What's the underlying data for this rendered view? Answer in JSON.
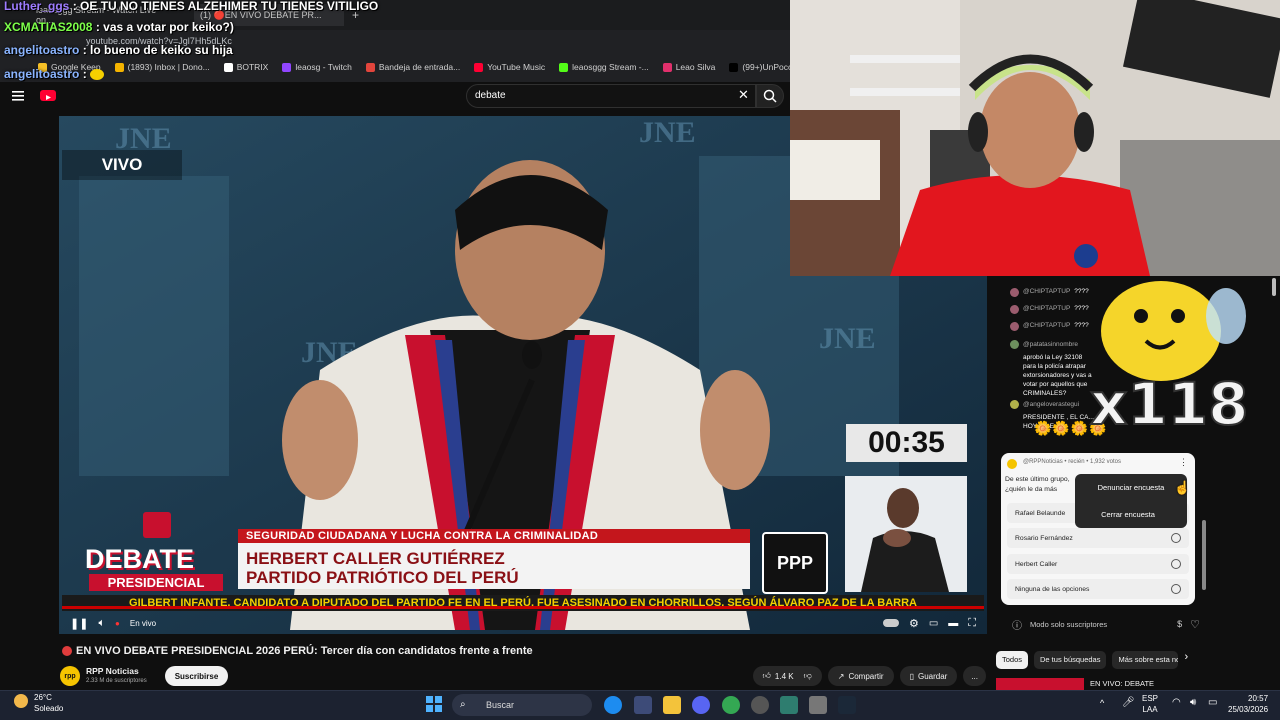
{
  "browser": {
    "tabs": [
      "leaosggg Stream - Watch Live on...",
      "(1) 🔴EN VIVO DEBATE PR..."
    ],
    "url": "youtube.com/watch?v=Jgl7Hh5dLKc",
    "bookmarks": [
      {
        "label": "Google Keep",
        "color": "#f6c026"
      },
      {
        "label": "(1893) Inbox | Dono...",
        "color": "#f5b400"
      },
      {
        "label": "BOTRIX",
        "color": "#ffffff"
      },
      {
        "label": "leaosg - Twitch",
        "color": "#9146ff"
      },
      {
        "label": "Bandeja de entrada...",
        "color": "#e2453c"
      },
      {
        "label": "YouTube Music",
        "color": "#ff0033"
      },
      {
        "label": "leaosggg Stream -...",
        "color": "#53fc18"
      },
      {
        "label": "Leao Silva",
        "color": "#e1306c"
      },
      {
        "label": "(99+)UnPocoDeLe...",
        "color": "#000000"
      }
    ]
  },
  "overlay_chat": [
    {
      "user": "Luther_ggs",
      "message": ": OE TU NO TIENES ALZEHIMER TU TIENES VITILIGO"
    },
    {
      "user": "XCMATIAS2008",
      "message": ": vas a votar por keiko?)"
    },
    {
      "user": "angelitoastro",
      "message": ": lo bueno de keiko su hija"
    },
    {
      "user": "angelitoastro",
      "message": ":"
    }
  ],
  "youtube": {
    "search_value": "debate",
    "video": {
      "live_tag": "VIVO",
      "jne": "JNE",
      "timer": "00:35",
      "ppp": "PPP",
      "lower_topic": "SEGURIDAD CIUDADANA Y LUCHA CONTRA LA CRIMINALIDAD",
      "name_line1": "HERBERT CALLER GUTIÉRREZ",
      "name_line2": "PARTIDO PATRIÓTICO DEL PERÚ",
      "debate_word": "DEBATE",
      "debate_sub": "PRESIDENCIAL",
      "ticker": "GILBERT INFANTE, CANDIDATO A DIPUTADO DEL PARTIDO FE EN EL PERÚ, FUE ASESINADO EN CHORRILLOS, SEGÚN ÁLVARO PAZ DE LA BARRA",
      "live_label": "En vivo"
    },
    "title": "EN VIVO DEBATE PRESIDENCIAL 2026 PERÚ: Tercer día con candidatos frente a frente",
    "channel": {
      "name": "RPP Noticias",
      "subs": "2.33 M de suscriptores",
      "subscribe": "Suscribirse",
      "avatar_text": "rpp"
    },
    "actions": {
      "likes": "1.4 K",
      "share": "Compartir",
      "save": "Guardar",
      "more": "..."
    },
    "chips": [
      "Todos",
      "De tus búsquedas",
      "Más sobre esta not"
    ],
    "recommend_title": "EN VIVO: DEBATE"
  },
  "chat": {
    "messages": [
      {
        "user": "@CHIPTAPTUP",
        "text": "????"
      },
      {
        "user": "@CHIPTAPTUP",
        "text": "????"
      },
      {
        "user": "@CHIPTAPTUP",
        "text": "????"
      },
      {
        "user": "@patatasinnombre",
        "text": "aprobó la Ley 32108 para la policía atrapar extorsionadores y vas a votar por aquellos que CRIMINALES?"
      },
      {
        "user": "@angeloverastegui",
        "text": "PRESIDENTE , EL CA... HOY ... LE"
      }
    ],
    "poll": {
      "header": "@RPPNoticias • recién • 1,932 votos",
      "question": "De este último grupo, ¿quién le da más confianza en seguridad?",
      "options": [
        "Rafael Belaunde",
        "Rosario Fernández",
        "Herbert Caller",
        "Ninguna de las opciones"
      ]
    },
    "menu": [
      "Denunciar encuesta",
      "Cerrar encuesta"
    ],
    "footer": "Modo solo suscriptores",
    "overlay_count": "x118"
  },
  "taskbar": {
    "temp": "26°C",
    "weather": "Soleado",
    "search": "Buscar",
    "lang1": "ESP",
    "lang2": "LAA",
    "time": "20:57",
    "date": "25/03/2026"
  }
}
